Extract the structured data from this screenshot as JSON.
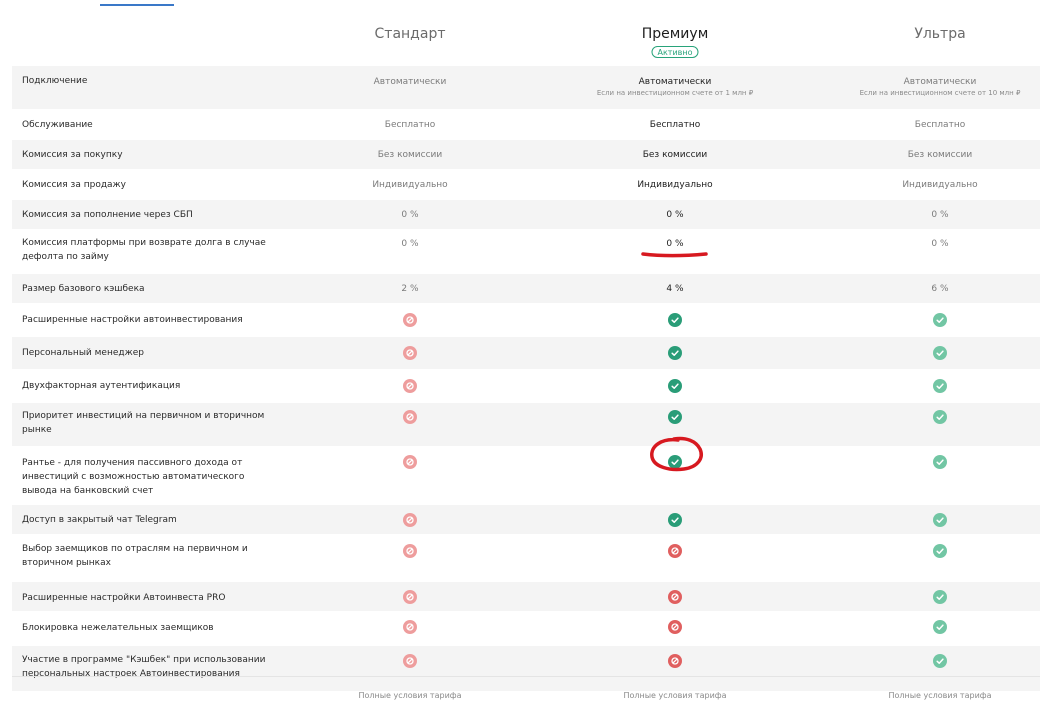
{
  "plans": [
    {
      "name": "Стандарт"
    },
    {
      "name": "Премиум",
      "badge": "Активно"
    },
    {
      "name": "Ультра"
    }
  ],
  "rows": [
    {
      "label": "Подключение",
      "values": [
        {
          "text": "Автоматически"
        },
        {
          "text": "Автоматически",
          "sub": "Если на инвестиционном счете от 1 млн ₽"
        },
        {
          "text": "Автоматически",
          "sub": "Если на инвестиционном счете от 10 млн ₽"
        }
      ]
    },
    {
      "label": "Обслуживание",
      "values": [
        {
          "text": "Бесплатно"
        },
        {
          "text": "Бесплатно"
        },
        {
          "text": "Бесплатно"
        }
      ]
    },
    {
      "label": "Комиссия за покупку",
      "values": [
        {
          "text": "Без комиссии"
        },
        {
          "text": "Без комиссии"
        },
        {
          "text": "Без комиссии"
        }
      ]
    },
    {
      "label": "Комиссия за продажу",
      "values": [
        {
          "text": "Индивидуально"
        },
        {
          "text": "Индивидуально"
        },
        {
          "text": "Индивидуально"
        }
      ]
    },
    {
      "label": "Комиссия за пополнение через СБП",
      "values": [
        {
          "text": "0 %"
        },
        {
          "text": "0 %"
        },
        {
          "text": "0 %"
        }
      ]
    },
    {
      "label": "Комиссия платформы при возврате долга в случае дефолта по займу",
      "values": [
        {
          "text": "0 %"
        },
        {
          "text": "0 %"
        },
        {
          "text": "0 %"
        }
      ]
    },
    {
      "label": "Размер базового кэшбека",
      "values": [
        {
          "text": "2 %"
        },
        {
          "text": "4 %"
        },
        {
          "text": "6 %"
        }
      ]
    },
    {
      "label": "Расширенные настройки автоинвестирования",
      "values": [
        {
          "icon": "no"
        },
        {
          "icon": "yes"
        },
        {
          "icon": "yes"
        }
      ]
    },
    {
      "label": "Персональный менеджер",
      "values": [
        {
          "icon": "no"
        },
        {
          "icon": "yes"
        },
        {
          "icon": "yes"
        }
      ]
    },
    {
      "label": "Двухфакторная аутентификация",
      "values": [
        {
          "icon": "no"
        },
        {
          "icon": "yes"
        },
        {
          "icon": "yes"
        }
      ]
    },
    {
      "label": "Приоритет инвестиций на первичном и вторичном рынке",
      "values": [
        {
          "icon": "no"
        },
        {
          "icon": "yes"
        },
        {
          "icon": "yes"
        }
      ]
    },
    {
      "label": "Рантье - для получения пассивного дохода от инвестиций с возможностью автоматического вывода на банковский счет",
      "values": [
        {
          "icon": "no"
        },
        {
          "icon": "yes"
        },
        {
          "icon": "yes"
        }
      ]
    },
    {
      "label": "Доступ в закрытый чат Telegram",
      "values": [
        {
          "icon": "no"
        },
        {
          "icon": "yes"
        },
        {
          "icon": "yes"
        }
      ]
    },
    {
      "label": "Выбор заемщиков по отраслям на первичном и вторичном рынках",
      "values": [
        {
          "icon": "no"
        },
        {
          "icon": "no"
        },
        {
          "icon": "yes"
        }
      ]
    },
    {
      "label": "Расширенные настройки Автоинвеста PRO",
      "values": [
        {
          "icon": "no"
        },
        {
          "icon": "no"
        },
        {
          "icon": "yes"
        }
      ]
    },
    {
      "label": "Блокировка нежелательных заемщиков",
      "values": [
        {
          "icon": "no"
        },
        {
          "icon": "no"
        },
        {
          "icon": "yes"
        }
      ]
    },
    {
      "label": "Участие в программе \"Кэшбек\" при использовании персональных настроек Автоинвестирования",
      "values": [
        {
          "icon": "no"
        },
        {
          "icon": "no"
        },
        {
          "icon": "yes"
        }
      ]
    }
  ],
  "footer": {
    "link_label": "Полные условия тарифа"
  },
  "colors": {
    "yes_strong": "#2a9d78",
    "yes_light": "#72c6a4",
    "no_strong": "#e05f5f",
    "no_light": "#ee9d9d",
    "annotation": "#d71920"
  }
}
